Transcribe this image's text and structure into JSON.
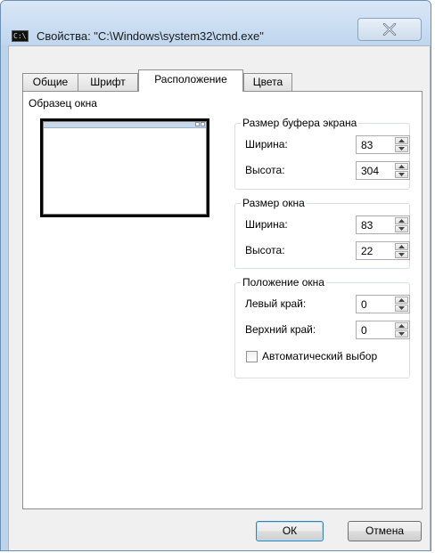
{
  "window": {
    "title": "Свойства: \"C:\\Windows\\system32\\cmd.exe\"",
    "icon_text": "C:\\."
  },
  "tabs": [
    {
      "label": "Общие",
      "active": false
    },
    {
      "label": "Шрифт",
      "active": false
    },
    {
      "label": "Расположение",
      "active": true
    },
    {
      "label": "Цвета",
      "active": false
    }
  ],
  "preview": {
    "label": "Образец окна"
  },
  "buffer": {
    "title": "Размер буфера экрана",
    "width_label": "Ширина:",
    "width_value": "83",
    "height_label": "Высота:",
    "height_value": "304"
  },
  "window_size": {
    "title": "Размер окна",
    "width_label": "Ширина:",
    "width_value": "83",
    "height_label": "Высота:",
    "height_value": "22"
  },
  "position": {
    "title": "Положение окна",
    "left_label": "Левый край:",
    "left_value": "0",
    "top_label": "Верхний край:",
    "top_value": "0",
    "auto_label": "Автоматический выбор",
    "auto_checked": false
  },
  "buttons": {
    "ok": "ОК",
    "cancel": "Отмена"
  },
  "colors": {
    "accent": "#3c7fb1",
    "frame": "#bcd3ea"
  }
}
